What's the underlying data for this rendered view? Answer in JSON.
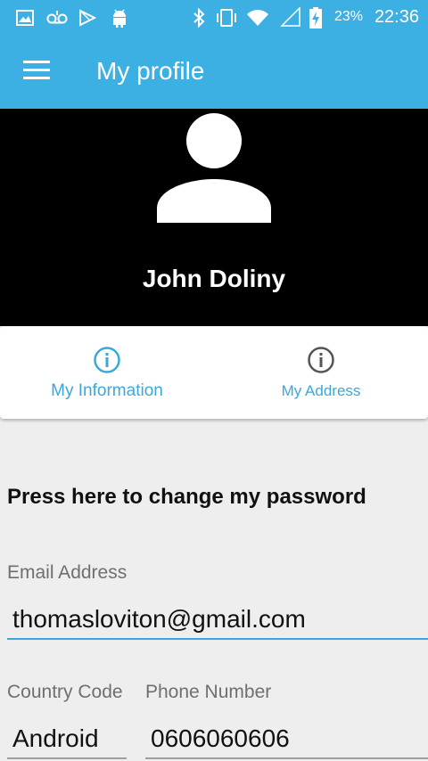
{
  "status_bar": {
    "battery_percent": "23%",
    "time": "22:36",
    "icons": [
      "image-icon",
      "voicemail-icon",
      "play-store-icon",
      "android-icon",
      "bluetooth-icon",
      "vibrate-icon",
      "wifi-icon",
      "signal-icon",
      "battery-charging-icon"
    ]
  },
  "app_bar": {
    "title": "My profile",
    "menu_icon": "hamburger-menu-icon"
  },
  "profile": {
    "name": "John Doliny",
    "avatar_icon": "person-avatar-icon"
  },
  "tabs": [
    {
      "label": "My Information",
      "icon": "info-icon",
      "selected": true
    },
    {
      "label": "My Address",
      "icon": "info-icon",
      "selected": false
    }
  ],
  "form": {
    "change_password": "Press here to change my password",
    "email_label": "Email Address",
    "email_value": "thomasloviton@gmail.com",
    "country_code_label": "Country Code",
    "country_code_value": "Android",
    "phone_label": "Phone Number",
    "phone_value": "0606060606"
  },
  "colors": {
    "primary": "#3db0e3",
    "accent_underline": "#3aa8dc",
    "header_bg": "#000000",
    "page_bg": "#eeeeee"
  }
}
